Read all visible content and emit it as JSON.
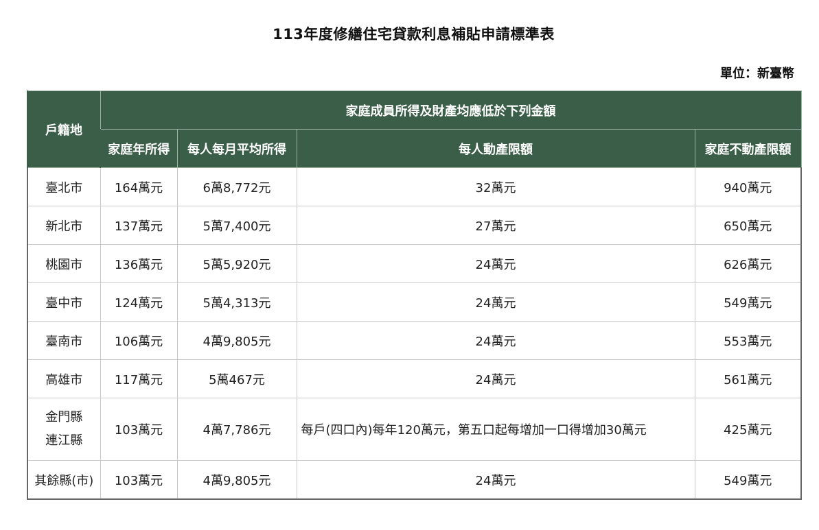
{
  "title": "113年度修繕住宅貸款利息補貼申請標準表",
  "unit": "單位：新臺幣",
  "header": {
    "region": "戶籍地",
    "group": "家庭成員所得及財產均應低於下列金額",
    "income": "家庭年所得",
    "monthly": "每人每月平均所得",
    "movable": "每人動產限額",
    "realestate": "家庭不動產限額"
  },
  "rows": [
    {
      "region": "臺北市",
      "income": "164萬元",
      "monthly": "6萬8,772元",
      "movable": "32萬元",
      "realestate": "940萬元"
    },
    {
      "region": "新北市",
      "income": "137萬元",
      "monthly": "5萬7,400元",
      "movable": "27萬元",
      "realestate": "650萬元"
    },
    {
      "region": "桃園市",
      "income": "136萬元",
      "monthly": "5萬5,920元",
      "movable": "24萬元",
      "realestate": "626萬元"
    },
    {
      "region": "臺中市",
      "income": "124萬元",
      "monthly": "5萬4,313元",
      "movable": "24萬元",
      "realestate": "549萬元"
    },
    {
      "region": "臺南市",
      "income": "106萬元",
      "monthly": "4萬9,805元",
      "movable": "24萬元",
      "realestate": "553萬元"
    },
    {
      "region": "高雄市",
      "income": "117萬元",
      "monthly": "5萬467元",
      "movable": "24萬元",
      "realestate": "561萬元"
    },
    {
      "region_line1": "金門縣",
      "region_line2": "連江縣",
      "income": "103萬元",
      "monthly": "4萬7,786元",
      "movable": "每戶(四口內)每年120萬元，第五口起每增加一口得增加30萬元",
      "realestate": "425萬元"
    },
    {
      "region": "其餘縣(市)",
      "income": "103萬元",
      "monthly": "4萬9,805元",
      "movable": "24萬元",
      "realestate": "549萬元"
    }
  ]
}
